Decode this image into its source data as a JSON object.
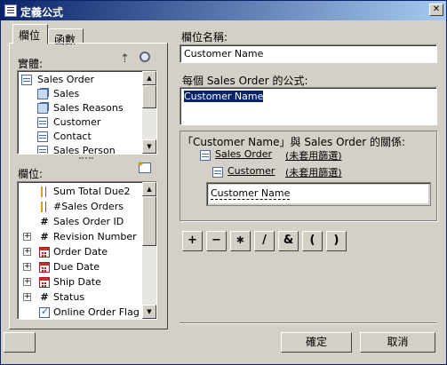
{
  "window": {
    "title": "定義公式"
  },
  "tabs": [
    {
      "label": "欄位"
    },
    {
      "label": "函數"
    }
  ],
  "entities": {
    "label": "實體:",
    "items": [
      {
        "label": "Sales Order",
        "icon": "table-icon"
      },
      {
        "label": "Sales",
        "icon": "table-set-icon"
      },
      {
        "label": "Sales Reasons",
        "icon": "table-set-icon"
      },
      {
        "label": "Customer",
        "icon": "table-icon"
      },
      {
        "label": "Contact",
        "icon": "table-icon"
      },
      {
        "label": "Sales Person",
        "icon": "table-icon"
      }
    ]
  },
  "fields": {
    "label": "欄位:",
    "items": [
      {
        "label": "Sum Total Due2",
        "icon": "calc-field-icon",
        "expandable": false
      },
      {
        "label": "#Sales Orders",
        "icon": "calc-field-icon",
        "expandable": false
      },
      {
        "label": "Sales Order ID",
        "icon": "number-icon",
        "expandable": false
      },
      {
        "label": "Revision Number",
        "icon": "number-icon",
        "expandable": true
      },
      {
        "label": "Order Date",
        "icon": "date-icon",
        "expandable": true
      },
      {
        "label": "Due Date",
        "icon": "date-icon",
        "expandable": true
      },
      {
        "label": "Ship Date",
        "icon": "date-icon",
        "expandable": true
      },
      {
        "label": "Status",
        "icon": "number-icon",
        "expandable": true
      },
      {
        "label": "Online Order Flag",
        "icon": "boolean-icon",
        "expandable": false
      }
    ]
  },
  "field_name": {
    "label": "欄位名稱:",
    "value": "Customer Name"
  },
  "formula": {
    "label": "每個 Sales Order 的公式:",
    "value": "Customer Name"
  },
  "relation": {
    "title": "「Customer Name」與 Sales Order 的關係:",
    "path": [
      {
        "label": "Sales Order",
        "filter": "(未套用篩選)"
      },
      {
        "label": "Customer",
        "filter": "(未套用篩選)"
      }
    ],
    "selected_field": "Customer Name"
  },
  "operators": [
    "+",
    "−",
    "∗",
    "/",
    "&",
    "(",
    ")"
  ],
  "buttons": {
    "ok": "確定",
    "cancel": "取消"
  }
}
